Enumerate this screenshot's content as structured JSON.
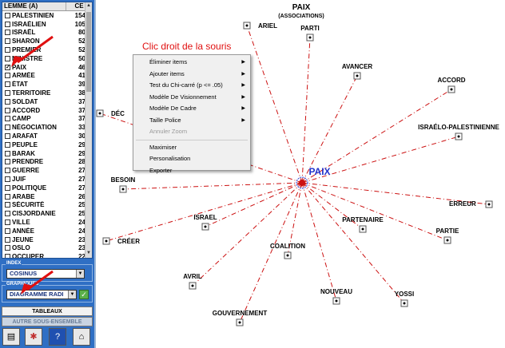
{
  "list": {
    "header_label": "LEMME (A)",
    "header_count": "CE",
    "items": [
      {
        "label": "PALESTINIEN",
        "count": "154",
        "checked": false
      },
      {
        "label": "ISRAÉLIEN",
        "count": "105",
        "checked": false
      },
      {
        "label": "ISRAËL",
        "count": "80",
        "checked": false
      },
      {
        "label": "SHARON",
        "count": "52",
        "checked": false
      },
      {
        "label": "PREMIER",
        "count": "52",
        "checked": false
      },
      {
        "label": "MINISTRE",
        "count": "50",
        "checked": false
      },
      {
        "label": "PAIX",
        "count": "46",
        "checked": true
      },
      {
        "label": "ARMÉE",
        "count": "41",
        "checked": false
      },
      {
        "label": "ÉTAT",
        "count": "39",
        "checked": false
      },
      {
        "label": "TERRITOIRE",
        "count": "38",
        "checked": false
      },
      {
        "label": "SOLDAT",
        "count": "37",
        "checked": false
      },
      {
        "label": "ACCORD",
        "count": "37",
        "checked": false
      },
      {
        "label": "CAMP",
        "count": "37",
        "checked": false
      },
      {
        "label": "NÉGOCIATION",
        "count": "33",
        "checked": false
      },
      {
        "label": "ARAFAT",
        "count": "30",
        "checked": false
      },
      {
        "label": "PEUPLE",
        "count": "29",
        "checked": false
      },
      {
        "label": "BARAK",
        "count": "29",
        "checked": false
      },
      {
        "label": "PRENDRE",
        "count": "28",
        "checked": false
      },
      {
        "label": "GUERRE",
        "count": "27",
        "checked": false
      },
      {
        "label": "JUIF",
        "count": "27",
        "checked": false
      },
      {
        "label": "POLITIQUE",
        "count": "27",
        "checked": false
      },
      {
        "label": "ARABE",
        "count": "26",
        "checked": false
      },
      {
        "label": "SÉCURITÉ",
        "count": "25",
        "checked": false
      },
      {
        "label": "CISJORDANIE",
        "count": "25",
        "checked": false
      },
      {
        "label": "VILLE",
        "count": "24",
        "checked": false
      },
      {
        "label": "ANNÉE",
        "count": "24",
        "checked": false
      },
      {
        "label": "JEUNE",
        "count": "23",
        "checked": false
      },
      {
        "label": "OSLO",
        "count": "23",
        "checked": false
      },
      {
        "label": "OCCUPER",
        "count": "22",
        "checked": false
      }
    ]
  },
  "index": {
    "title": "INDEX",
    "value": "COSINUS"
  },
  "graphiques": {
    "title": "GRAPHIQUES",
    "value": "DIAGRAMME RADI"
  },
  "buttons": {
    "tableaux": "TABLEAUX",
    "autre": "AUTRE SOUS-ENSEMBLE"
  },
  "toolbar_icons": [
    "print-icon",
    "network-icon",
    "help-icon",
    "home-icon"
  ],
  "chart": {
    "title": "PAIX",
    "subtitle": "(ASSOCIATIONS)",
    "center_label": "PAIX",
    "nodes": [
      "ARIEL",
      "PARTI",
      "AVANCER",
      "ACCORD",
      "ISRAÉLO-PALESTINIENNE",
      "ERREUR",
      "PARTIE",
      "YOSSI",
      "NOUVEAU",
      "PARTENAIRE",
      "COALITION",
      "GOUVERNEMENT",
      "AVRIL",
      "ISRAEL",
      "CRÉER",
      "BESOIN",
      "DÉC"
    ]
  },
  "annotation": "Clic droit de la souris",
  "context_menu": [
    {
      "label": "Éliminer items",
      "submenu": true,
      "disabled": false
    },
    {
      "label": "Ajouter items",
      "submenu": true,
      "disabled": false
    },
    {
      "label": "Test du Chi-carré (p <= .05)",
      "submenu": true,
      "disabled": false
    },
    {
      "label": "Modèle De Visionnement",
      "submenu": true,
      "disabled": false
    },
    {
      "label": "Modèle De Cadre",
      "submenu": true,
      "disabled": false
    },
    {
      "label": "Taille Police",
      "submenu": true,
      "disabled": false
    },
    {
      "label": "Annuler Zoom",
      "submenu": false,
      "disabled": true
    },
    {
      "separator": true
    },
    {
      "label": "Maximiser",
      "submenu": false,
      "disabled": false
    },
    {
      "label": "Personalisation",
      "submenu": false,
      "disabled": false
    },
    {
      "label": "Exporter",
      "submenu": false,
      "disabled": false
    }
  ],
  "colors": {
    "accent": "#2f6fc4",
    "center": "#2233cc",
    "line": "#cc1111",
    "annotation": "#e01010"
  }
}
